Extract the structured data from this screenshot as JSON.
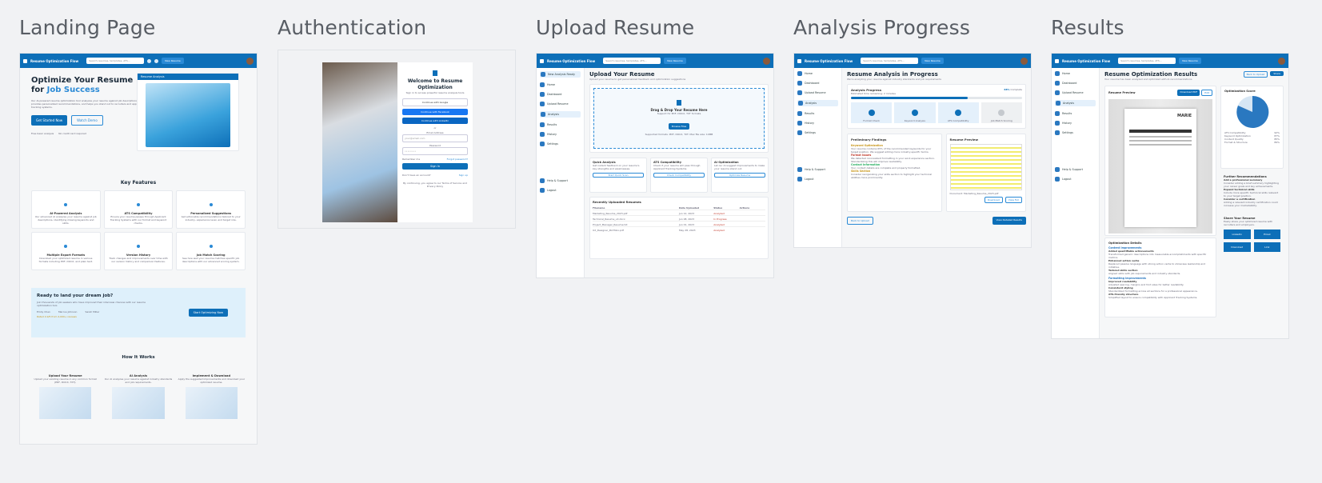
{
  "frames": {
    "landing": {
      "title": "Landing Page",
      "app_name": "Resume Optimization Flow",
      "search_placeholder": "Search resumes, templates, ATS...",
      "hero_title_1": "Optimize Your Resume",
      "hero_title_2a": "for",
      "hero_title_2b": "Job Success",
      "hero_text": "Our AI-powered resume optimization tool analyzes your resume against job descriptions, provides personalized recommendations, and helps you stand out to recruiters and applicant tracking systems.",
      "primary_cta": "Get Started Now",
      "secondary_cta": "Watch Demo",
      "trust_1": "Free basic analysis",
      "trust_2": "No credit card required",
      "hero_card_title": "Resume Analysis",
      "features_heading": "Key Features",
      "features": [
        {
          "title": "AI-Powered Analysis",
          "text": "Our advanced AI analyzes your resume against job descriptions, identifying missing keywords and skills."
        },
        {
          "title": "ATS Compatibility",
          "text": "Ensure your resume passes through Applicant Tracking Systems with our format and keyword checks."
        },
        {
          "title": "Personalized Suggestions",
          "text": "Get actionable recommendations tailored to your industry, experience level, and target role."
        },
        {
          "title": "Multiple Export Formats",
          "text": "Download your optimized resume in various formats including PDF, DOCX, and plain text."
        },
        {
          "title": "Version History",
          "text": "Track changes and improvements over time with our version history and comparison features."
        },
        {
          "title": "Job Match Scoring",
          "text": "See how well your resume matches specific job descriptions with our advanced scoring system."
        }
      ],
      "cta_title": "Ready to land your dream job?",
      "cta_text": "Join thousands of job seekers who have improved their interview chances with our resume optimization tool.",
      "cta_button": "Start Optimizing Now",
      "testimonials": [
        "Emily Chen",
        "Marcus Johnson",
        "Sarah Miller"
      ],
      "rating_text": "Rated 4.9/5 from 2,000+ reviews",
      "how_heading": "How It Works",
      "steps": [
        {
          "title": "Upload Your Resume",
          "text": "Upload your existing resume in any common format (PDF, DOCX, TXT)."
        },
        {
          "title": "AI Analysis",
          "text": "Our AI analyzes your resume against industry standards and job requirements."
        },
        {
          "title": "Implement & Download",
          "text": "Apply the suggested improvements and download your optimized resume."
        }
      ]
    },
    "auth": {
      "title": "Authentication",
      "welcome": "Welcome to Resume Optimization",
      "sub": "Sign in to access powerful resume analysis tools",
      "continue_google": "Continue with Google",
      "continue_facebook": "Continue with Facebook",
      "continue_linkedin": "Continue with LinkedIn",
      "or": "or",
      "email_label": "Email Address",
      "email_placeholder": "your@email.com",
      "password_label": "Password",
      "password_placeholder": "••••••••",
      "remember": "Remember me",
      "forgot": "Forgot password?",
      "sign_in": "Sign In",
      "no_account": "Don't have an account?",
      "sign_up": "Sign up",
      "terms": "By continuing, you agree to our Terms of Service and Privacy Policy"
    },
    "upload": {
      "title": "Upload Resume",
      "heading": "Upload Your Resume",
      "sub": "Upload your resume to get personalized feedback and optimization suggestions",
      "drop_title": "Drag & Drop Your Resume Here",
      "drop_sub": "Support for PDF, DOCX, TXT formats",
      "browse": "Browse Files",
      "drop_note": "Supported formats: PDF, DOCX, TXT. Max file size: 10MB",
      "options": [
        {
          "title": "Quick Analysis",
          "text": "Get instant feedback on your resume's key strengths and weaknesses.",
          "button": "Start Quick Scan"
        },
        {
          "title": "ATS Compatibility",
          "text": "Check if your resume will pass through Applicant Tracking Systems.",
          "button": "Check Compatibility"
        },
        {
          "title": "AI Optimization",
          "text": "Let our AI suggest improvements to make your resume stand out.",
          "button": "Optimize Resume"
        }
      ],
      "recent_heading": "Recently Uploaded Resumes",
      "table_headers": [
        "Filename",
        "Date Uploaded",
        "Status",
        "Actions"
      ],
      "rows": [
        {
          "file": "Marketing_Resume_2023.pdf",
          "date": "Jun 12, 2023",
          "status": "Analyzed"
        },
        {
          "file": "Technical_Resume_v2.docx",
          "date": "Jun 08, 2023",
          "status": "In Progress"
        },
        {
          "file": "Project_Manager_Resume.txt",
          "date": "Jun 01, 2023",
          "status": "Analyzed"
        },
        {
          "file": "UX_Designer_Portfolio.pdf",
          "date": "May 28, 2023",
          "status": "Analyzed"
        }
      ]
    },
    "progress": {
      "title": "Analysis Progress",
      "heading": "Resume Analysis in Progress",
      "sub": "We're analyzing your resume against industry standards and job requirements",
      "progress_label": "Analysis Progress",
      "progress_sub": "Estimated time remaining: 2 minutes",
      "progress_pct": "68%",
      "progress_value": 0.68,
      "complete": "Complete",
      "steps": [
        "Format Check",
        "Keyword Analysis",
        "ATS Compatibility",
        "Job Match Scoring"
      ],
      "findings_heading": "Preliminary Findings",
      "findings": [
        {
          "title": "Keyword Optimization",
          "text": "Your resume contains 65% of the recommended keywords for your target position. We suggest adding more industry-specific terms."
        },
        {
          "title": "Format Issues",
          "text": "We detected inconsistent formatting in your work experience section. Standardizing this will improve readability."
        },
        {
          "title": "Contact Information",
          "text": "Your contact details are complete and properly formatted."
        },
        {
          "title": "Skills Section",
          "text": "Consider reorganizing your skills section to highlight your technical abilities more prominently."
        }
      ],
      "preview_heading": "Resume Preview",
      "preview_caption": "Document: Marketing_Resume_2023.pdf",
      "download_btn": "Download",
      "full_btn": "View Full",
      "back_btn": "Back to Upload",
      "results_btn": "View Detailed Results"
    },
    "results": {
      "title": "Results",
      "heading": "Resume Optimization Results",
      "sub": "Your resume has been analyzed and optimized with AI recommendations",
      "back_btn": "Back to Upload",
      "share_btn": "Share",
      "preview_heading": "Resume Preview",
      "download_pdf": "Download PDF",
      "edit_btn": "Edit",
      "resume_name": "MARIE",
      "score_heading": "Optimization Score",
      "metrics": [
        {
          "label": "ATS Compatibility",
          "value": "92%"
        },
        {
          "label": "Keyword Optimization",
          "value": "87%"
        },
        {
          "label": "Content Quality",
          "value": "85%"
        },
        {
          "label": "Format & Structure",
          "value": "89%"
        }
      ],
      "recs_heading": "Further Recommendations",
      "recs": [
        {
          "title": "Add a professional summary",
          "text": "Consider adding a brief summary highlighting your career goals and key achievements."
        },
        {
          "title": "Expand technical skills",
          "text": "Include more specific technical skills relevant to your target position."
        },
        {
          "title": "Consider a certification",
          "text": "Adding a relevant industry certification could increase your marketability."
        }
      ],
      "share_heading": "Share Your Resume",
      "share_text": "Easily share your optimized resume with recruiters and employers.",
      "share_buttons": [
        "LinkedIn",
        "Email",
        "Download",
        "Link"
      ],
      "details_heading": "Optimization Details",
      "content_heading": "Content Improvements",
      "content_items": [
        {
          "title": "Added quantifiable achievements",
          "text": "Transformed generic descriptions into measurable accomplishments with specific metrics."
        },
        {
          "title": "Enhanced action verbs",
          "text": "Replaced passive language with strong action verbs to showcase leadership and initiative."
        },
        {
          "title": "Tailored skills section",
          "text": "Aligned skills with job requirements and industry standards."
        }
      ],
      "format_heading": "Formatting Improvements",
      "format_items": [
        {
          "title": "Improved readability",
          "text": "Adjusted spacing, margins and font sizes for better readability."
        },
        {
          "title": "Consistent styling",
          "text": "Standardized formatting across all sections for a professional appearance."
        },
        {
          "title": "ATS-friendly structure",
          "text": "Simplified layout to ensure compatibility with Applicant Tracking Systems."
        }
      ]
    }
  },
  "sidebar": [
    "New Analysis Ready",
    "Home",
    "Dashboard",
    "Upload Resume",
    "Analysis",
    "Results",
    "History",
    "Settings",
    "Help & Support",
    "Logout"
  ],
  "colors": {
    "primary": "#0d6fb8",
    "accent": "#2a8ad6",
    "page": "#f1f2f4"
  }
}
